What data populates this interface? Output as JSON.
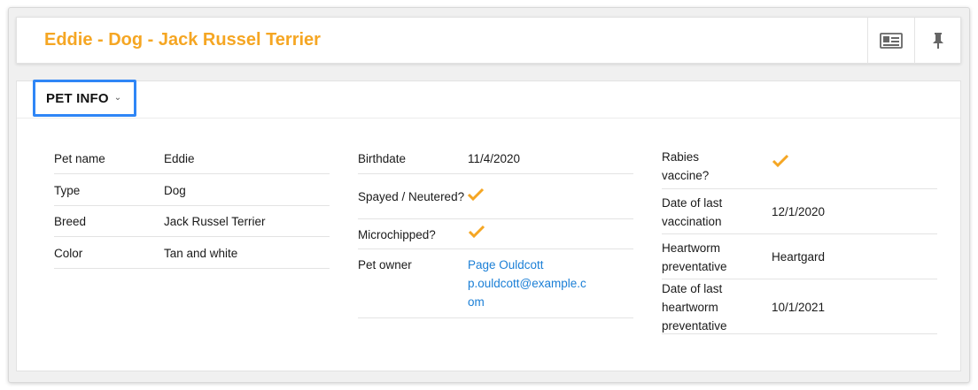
{
  "header": {
    "title": "Eddie - Dog - Jack Russel Terrier",
    "card_icon": "id-card-icon",
    "pin_icon": "pushpin-icon"
  },
  "section": {
    "label": "PET INFO",
    "chevron_icon": "chevron-down-icon"
  },
  "colors": {
    "accent": "#f5a623",
    "link": "#1b7fd6",
    "focus": "#2f86f6"
  },
  "columns": [
    [
      {
        "label": "Pet name",
        "value": "Eddie"
      },
      {
        "label": "Type",
        "value": "Dog"
      },
      {
        "label": "Breed",
        "value": "Jack Russel Terrier"
      },
      {
        "label": "Color",
        "value": "Tan and white"
      }
    ],
    [
      {
        "label": "Birthdate",
        "value": "11/4/2020"
      },
      {
        "label": "Spayed / Neutered?",
        "value": true
      },
      {
        "label": "Microchipped?",
        "value": true
      },
      {
        "label": "Pet owner",
        "link_name": "Page Ouldcott",
        "link_email": "p.ouldcott@example.com"
      }
    ],
    [
      {
        "label": "Rabies vaccine?",
        "value": true
      },
      {
        "label": "Date of last vaccination",
        "value": "12/1/2020"
      },
      {
        "label": "Heartworm preventative",
        "value": "Heartgard"
      },
      {
        "label": "Date of last heartworm preventative",
        "value": "10/1/2021"
      }
    ]
  ]
}
